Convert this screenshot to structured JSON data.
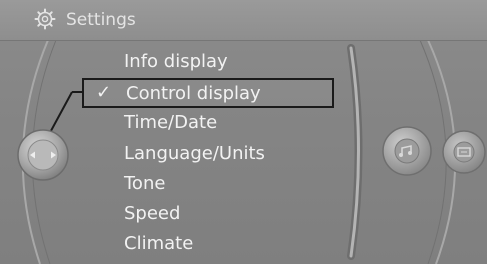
{
  "header": {
    "icon": "gear-icon",
    "title": "Settings"
  },
  "menu": {
    "items": [
      {
        "label": "Info display",
        "selected": false
      },
      {
        "label": "Control display",
        "selected": true
      },
      {
        "label": "Time/Date",
        "selected": false
      },
      {
        "label": "Language/Units",
        "selected": false
      },
      {
        "label": "Tone",
        "selected": false
      },
      {
        "label": "Speed",
        "selected": false
      },
      {
        "label": "Climate",
        "selected": false
      }
    ]
  },
  "controller": {
    "icon": "left-right-arrows-icon"
  },
  "side_controls": [
    {
      "icon": "media-icon"
    },
    {
      "icon": "display-icon"
    }
  ],
  "colors": {
    "background": "#858585",
    "text": "#f2f2f2",
    "title_text": "#e4e4e4",
    "highlight_border": "#1a1a1a"
  }
}
